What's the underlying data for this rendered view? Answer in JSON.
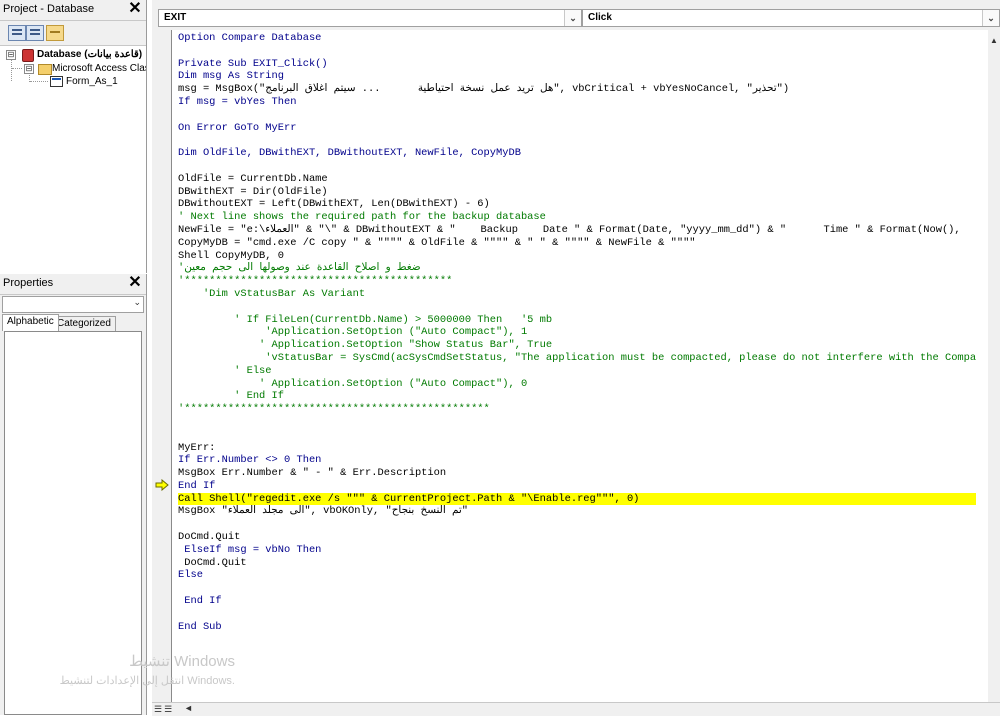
{
  "project_pane": {
    "title": "Project - Database",
    "close": "✕",
    "tree": [
      {
        "label": "Database (قاعدة بيانات)",
        "expander": "⊟"
      },
      {
        "label": "Microsoft Access Class C",
        "expander": "⊟"
      },
      {
        "label": "Form_As_1"
      }
    ]
  },
  "properties_pane": {
    "title": "Properties",
    "close": "✕",
    "combo_arrow": "⌄",
    "tabs": [
      "Alphabetic",
      "Categorized"
    ]
  },
  "code_window": {
    "object_combo": "EXIT",
    "procedure_combo": "Click",
    "combo_drop": "⌄",
    "scroll_up": "▲",
    "scroll_left": "◄",
    "view_buttons": "☰☰",
    "lines": [
      {
        "t": "Option Compare Database",
        "c": "kw"
      },
      {
        "t": "",
        "c": ""
      },
      {
        "t": "Private Sub EXIT_Click()",
        "c": "kw"
      },
      {
        "t": "Dim msg As String",
        "c": "kw"
      },
      {
        "t": "msg = MsgBox(\"هل تريد عمل نسخة احتياطية      ... سيتم اغلاق البرنامج\", vbCritical + vbYesNoCancel, \"تحذير\")",
        "c": ""
      },
      {
        "t": "If msg = vbYes Then",
        "c": "kw"
      },
      {
        "t": "",
        "c": ""
      },
      {
        "t": "On Error GoTo MyErr",
        "c": "kw"
      },
      {
        "t": "",
        "c": ""
      },
      {
        "t": "Dim OldFile, DBwithEXT, DBwithoutEXT, NewFile, CopyMyDB",
        "c": "kw"
      },
      {
        "t": "",
        "c": ""
      },
      {
        "t": "OldFile = CurrentDb.Name",
        "c": ""
      },
      {
        "t": "DBwithEXT = Dir(OldFile)",
        "c": ""
      },
      {
        "t": "DBwithoutEXT = Left(DBwithEXT, Len(DBwithEXT) - 6)",
        "c": ""
      },
      {
        "t": "' Next line shows the required path for the backup database",
        "c": "cm"
      },
      {
        "t": "NewFile = \"e:\\العملاء\" & \"\\\" & DBwithoutEXT & \"    Backup    Date \" & Format(Date, \"yyyy_mm_dd\") & \"      Time \" & Format(Now(),",
        "c": ""
      },
      {
        "t": "CopyMyDB = \"cmd.exe /C copy \" & \"\"\"\" & OldFile & \"\"\"\" & \" \" & \"\"\"\" & NewFile & \"\"\"\"",
        "c": ""
      },
      {
        "t": "Shell CopyMyDB, 0",
        "c": ""
      },
      {
        "t": "'ضغط و اصلاح القاعدة عند وصولها الى حجم معين",
        "c": "cm"
      },
      {
        "t": "'*******************************************",
        "c": "cm"
      },
      {
        "t": "    'Dim vStatusBar As Variant",
        "c": "cm"
      },
      {
        "t": "",
        "c": ""
      },
      {
        "t": "         ' If FileLen(CurrentDb.Name) > 5000000 Then   '5 mb",
        "c": "cm"
      },
      {
        "t": "              'Application.SetOption (\"Auto Compact\"), 1",
        "c": "cm"
      },
      {
        "t": "             ' Application.SetOption \"Show Status Bar\", True",
        "c": "cm"
      },
      {
        "t": "              'vStatusBar = SysCmd(acSysCmdSetStatus, \"The application must be compacted, please do not interfere with the Compa",
        "c": "cm"
      },
      {
        "t": "         ' Else",
        "c": "cm"
      },
      {
        "t": "             ' Application.SetOption (\"Auto Compact\"), 0",
        "c": "cm"
      },
      {
        "t": "         ' End If",
        "c": "cm"
      },
      {
        "t": "'*************************************************",
        "c": "cm"
      },
      {
        "t": "",
        "c": ""
      },
      {
        "t": "",
        "c": ""
      },
      {
        "t": "MyErr:",
        "c": ""
      },
      {
        "t": "If Err.Number <> 0 Then",
        "c": "kw"
      },
      {
        "t": "MsgBox Err.Number & \" - \" & Err.Description",
        "c": ""
      },
      {
        "t": "End If",
        "c": "kw"
      },
      {
        "t": "Call Shell(\"regedit.exe /s \"\"\" & CurrentProject.Path & \"\\Enable.reg\"\"\", 0)",
        "c": "hl"
      },
      {
        "t": "MsgBox \"الى مجلد العملاء\", vbOKOnly, \"تم النسخ بنجاح\"",
        "c": ""
      },
      {
        "t": "",
        "c": ""
      },
      {
        "t": "DoCmd.Quit",
        "c": ""
      },
      {
        "t": " ElseIf msg = vbNo Then",
        "c": "kw"
      },
      {
        "t": " DoCmd.Quit",
        "c": ""
      },
      {
        "t": "Else",
        "c": "kw"
      },
      {
        "t": "",
        "c": ""
      },
      {
        "t": " End If",
        "c": "kw"
      },
      {
        "t": "",
        "c": ""
      },
      {
        "t": "End Sub",
        "c": "kw"
      }
    ]
  },
  "watermark": {
    "line1": "تنشيط Windows",
    "line2": "انتقل إلى الإعدادات لتنشيط Windows."
  }
}
